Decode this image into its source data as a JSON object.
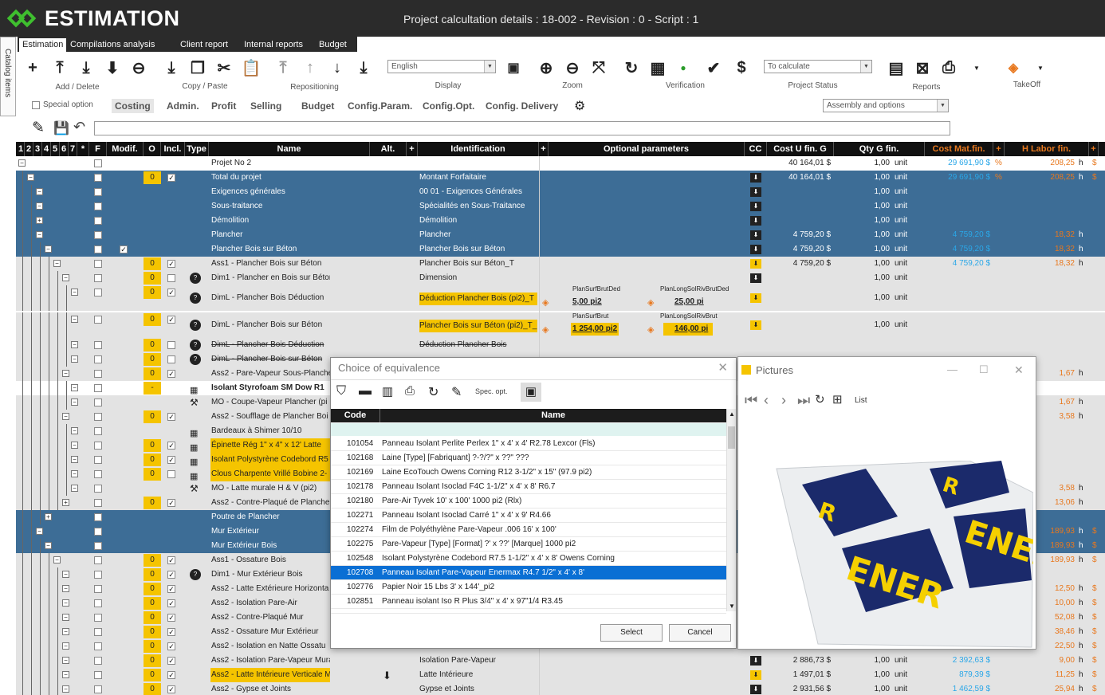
{
  "app": {
    "name": "ESTIMATION",
    "title": "Project calcultation details : 18-002 - Revision : 0 - Script : 1"
  },
  "tabs": [
    "Estimation",
    "Compilations analysis",
    "Client report",
    "Internal reports",
    "Budget"
  ],
  "sidebar": {
    "label": "Catalog items"
  },
  "ribbon": {
    "groups": {
      "add_delete": "Add / Delete",
      "copy_paste": "Copy / Paste",
      "repositioning": "Repositioning",
      "display": "Display",
      "zoom": "Zoom",
      "verification": "Verification",
      "project_status": "Project Status",
      "reports": "Reports",
      "takeoff": "TakeOff"
    },
    "language": "English",
    "status": "To calculate",
    "view": "Assembly and options"
  },
  "subtabs": {
    "special_option": "Special option",
    "items": [
      "Costing",
      "Admin.",
      "Profit",
      "Selling",
      "Budget",
      "Config.Param.",
      "Config.Opt.",
      "Config. Delivery"
    ]
  },
  "grid": {
    "headers": {
      "levels": [
        "1",
        "2",
        "3",
        "4",
        "5",
        "6",
        "7",
        "*"
      ],
      "f": "F",
      "modif": "Modif.",
      "o": "O",
      "incl": "Incl.",
      "type": "Type",
      "name": "Name",
      "alt": "Alt.",
      "plus": "+",
      "identification": "Identification",
      "optional": "Optional parameters",
      "cc": "CC",
      "cost_u": "Cost U fin. G",
      "qty": "Qty G fin.",
      "cost_mat": "Cost Mat.fin.",
      "labor": "H Labor fin."
    },
    "rows": [
      {
        "name": "Projet No 2",
        "ident": "",
        "cost": "40 164,01 $",
        "qty": "1,00",
        "unit": "unit",
        "mat": "29 691,90 $",
        "matu": "%",
        "labor": "208,25",
        "lu": "h",
        "cur": "$"
      },
      {
        "o": "0",
        "name": "Total du projet",
        "ident": "Montant Forfaitaire",
        "cost": "40 164,01 $",
        "qty": "1,00",
        "unit": "unit",
        "mat": "29 691,90 $",
        "matu": "%",
        "labor": "208,25",
        "lu": "h",
        "cur": "$"
      },
      {
        "name": "Exigences générales",
        "ident": "00 01 - Exigences Générales",
        "qty": "1,00",
        "unit": "unit"
      },
      {
        "name": "Sous-traitance",
        "ident": "Spécialités en Sous-Traitance",
        "qty": "1,00",
        "unit": "unit"
      },
      {
        "name": "Démolition",
        "ident": "Démolition",
        "qty": "1,00",
        "unit": "unit"
      },
      {
        "name": "Plancher",
        "ident": "Plancher",
        "cost": "4 759,20 $",
        "qty": "1,00",
        "unit": "unit",
        "mat": "4 759,20 $",
        "labor": "18,32",
        "lu": "h"
      },
      {
        "name": "Plancher Bois sur Béton",
        "ident": "Plancher Bois sur Béton",
        "cost": "4 759,20 $",
        "qty": "1,00",
        "unit": "unit",
        "mat": "4 759,20 $",
        "labor": "18,32",
        "lu": "h"
      },
      {
        "o": "0",
        "name": "Ass1 - Plancher Bois sur Béton",
        "ident": "Plancher Bois sur Béton_T",
        "cost": "4 759,20 $",
        "qty": "1,00",
        "unit": "unit",
        "mat": "4 759,20 $",
        "labor": "18,32",
        "lu": "h"
      },
      {
        "o": "0",
        "name": "Dim1 - Plancher en Bois sur Béton",
        "ident": "Dimension",
        "qty": "1,00",
        "unit": "unit"
      },
      {
        "o": "0",
        "name": "DimL - Plancher Bois Déduction",
        "ident": "Déduction Plancher Bois (pi2)_T",
        "p1n": "PlanSurfBrutDed",
        "p1v": "5,00",
        "p1u": "pi2",
        "p2n": "PlanLongSolRivBrutDed",
        "p2v": "25,00",
        "p2u": "pi",
        "qty": "1,00",
        "unit": "unit"
      },
      {
        "o": "0",
        "name": "DimL - Plancher Bois sur Béton",
        "ident": "Plancher Bois sur Béton (pi2)_T_",
        "p1n": "PlanSurfBrut",
        "p1v": "1 254,00",
        "p1u": "pi2",
        "p2n": "PlanLongSolRivBrut",
        "p2v": "146,00",
        "p2u": "pi",
        "qty": "1,00",
        "unit": "unit"
      },
      {
        "o": "0",
        "name": "DimL - Plancher Bois Déduction",
        "ident": "Déduction Plancher Bois"
      },
      {
        "o": "0",
        "name": "DimL - Plancher Bois sur Béton"
      },
      {
        "o": "0",
        "name": "Ass2 - Pare-Vapeur Sous-Planche",
        "labor": "1,67",
        "lu": "h"
      },
      {
        "o": "-",
        "name": "Isolant Styrofoam SM Dow R1"
      },
      {
        "name": "MO - Coupe-Vapeur Plancher (pi",
        "labor": "1,67",
        "lu": "h"
      },
      {
        "o": "0",
        "name": "Ass2 - Soufflage de Plancher Boi",
        "labor": "3,58",
        "lu": "h"
      },
      {
        "name": "Bardeaux à Shimer 10/10"
      },
      {
        "o": "0",
        "name": "Épinette Rég   1\" x  4\" x 12' Latte"
      },
      {
        "o": "0",
        "name": "Isolant Polystyrène Codebord R5"
      },
      {
        "o": "0",
        "name": "Clous Charpente Vrillé Bobine 2-"
      },
      {
        "name": "MO - Latte murale H & V (pi2)",
        "labor": "3,58",
        "lu": "h"
      },
      {
        "o": "0",
        "name": "Ass2 - Contre-Plaqué de Planche",
        "labor": "13,06",
        "lu": "h"
      },
      {
        "name": "Poutre de Plancher"
      },
      {
        "name": "Mur Extérieur",
        "labor": "189,93",
        "lu": "h",
        "cur": "$"
      },
      {
        "name": "Mur Extérieur Bois",
        "labor": "189,93",
        "lu": "h",
        "cur": "$"
      },
      {
        "o": "0",
        "name": "Ass1 - Ossature Bois",
        "labor": "189,93",
        "lu": "h",
        "cur": "$"
      },
      {
        "o": "0",
        "name": "Dim1 - Mur Extérieur Bois"
      },
      {
        "o": "0",
        "name": "Ass2 - Latte Extérieure Horizonta",
        "labor": "12,50",
        "lu": "h",
        "cur": "$"
      },
      {
        "o": "0",
        "name": "Ass2 - Isolation Pare-Air",
        "labor": "10,00",
        "lu": "h",
        "cur": "$"
      },
      {
        "o": "0",
        "name": "Ass2 - Contre-Plaqué Mur",
        "labor": "52,08",
        "lu": "h",
        "cur": "$"
      },
      {
        "o": "0",
        "name": "Ass2 - Ossature Mur Extérieur",
        "labor": "38,46",
        "lu": "h",
        "cur": "$"
      },
      {
        "o": "0",
        "name": "Ass2 - Isolation en Natte Ossatu",
        "labor": "22,50",
        "lu": "h",
        "cur": "$"
      },
      {
        "o": "0",
        "name": "Ass2 - Isolation Pare-Vapeur Murale",
        "ident": "Isolation Pare-Vapeur",
        "cost": "2 886,73 $",
        "qty": "1,00",
        "unit": "unit",
        "mat": "2 392,63 $",
        "labor": "9,00",
        "lu": "h",
        "cur": "$"
      },
      {
        "o": "0",
        "name": "Ass2 - Latte Intérieure Verticale Mur",
        "ident": "Latte Intérieure",
        "cost": "1 497,01 $",
        "qty": "1,00",
        "unit": "unit",
        "mat": "879,39 $",
        "labor": "11,25",
        "lu": "h",
        "cur": "$"
      },
      {
        "o": "0",
        "name": "Ass2 - Gypse et Joints",
        "ident": "Gypse et Joints",
        "cost": "2 931,56 $",
        "qty": "1,00",
        "unit": "unit",
        "mat": "1 462,59 $",
        "labor": "25,94",
        "lu": "h",
        "cur": "$"
      }
    ]
  },
  "dialog": {
    "title": "Choice of equivalence",
    "spec": "Spec. opt.",
    "cols": {
      "code": "Code",
      "name": "Name"
    },
    "rows": [
      {
        "code": "101054",
        "name": "Panneau Isolant Perlite Perlex 1\" x 4' x 4' R2.78 Lexcor (Fls)"
      },
      {
        "code": "102168",
        "name": "Laine  [Type]  [Fabriquant] ?-?/?\" x ??\" ???"
      },
      {
        "code": "102169",
        "name": "Laine EcoTouch Owens Corning R12  3-1/2\" x 15\" (97.9 pi2)"
      },
      {
        "code": "102178",
        "name": "Panneau Isolant Isoclad F4C 1-1/2\" x 4' x 8' R6.7"
      },
      {
        "code": "102180",
        "name": "Pare-Air Tyvek 10' x 100' 1000 pi2  (Rlx)"
      },
      {
        "code": "102271",
        "name": "Panneau Isolant Isoclad Carré 1\" x 4' x 9' R4.66"
      },
      {
        "code": "102274",
        "name": "Film de Polyéthylène  Pare-Vapeur .006 16' x 100'"
      },
      {
        "code": "102275",
        "name": "Pare-Vapeur [Type]  [Format] ?' x ??' [Marque] 1000 pi2"
      },
      {
        "code": "102548",
        "name": "Isolant Polystyrène Codebord R7.5  1-1/2\" x 4' x 8' Owens Corning"
      },
      {
        "code": "102708",
        "name": "Panneau Isolant Pare-Vapeur Enermax R4.7 1/2\" x 4' x 8'"
      },
      {
        "code": "102776",
        "name": "Papier Noir 15 Lbs 3' x 144'_pi2"
      },
      {
        "code": "102851",
        "name": "Panneau isolant Iso R Plus 3/4\" x 4' x 97\"1/4 R3.45"
      }
    ],
    "select": "Select",
    "cancel": "Cancel"
  },
  "pictures": {
    "title": "Pictures",
    "list": "List",
    "brand": "ENER"
  }
}
